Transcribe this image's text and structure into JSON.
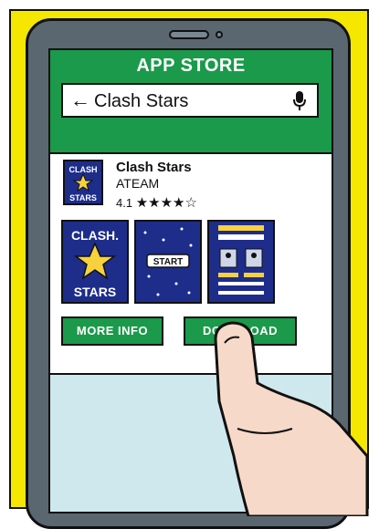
{
  "store": {
    "title": "APP STORE",
    "search_value": "Clash Stars"
  },
  "app": {
    "name": "Clash Stars",
    "developer": "ATEAM",
    "rating_value": "4.1",
    "rating_stars": "★★★★☆",
    "icon_text": [
      "CLASH",
      "STARS"
    ]
  },
  "screenshots": [
    {
      "label_lines": [
        "CLASH.",
        "STARS"
      ]
    },
    {
      "label": "START"
    },
    {
      "label": ""
    }
  ],
  "buttons": {
    "more_info": "MORE INFO",
    "download": "DOWNLOAD"
  },
  "colors": {
    "accent_green": "#1a9a4a",
    "background_yellow": "#f5e700",
    "app_blue": "#1e2d8a",
    "star_yellow": "#f7d23e"
  },
  "icons": [
    "back-arrow-icon",
    "microphone-icon",
    "star-icon",
    "hand-pointer"
  ]
}
